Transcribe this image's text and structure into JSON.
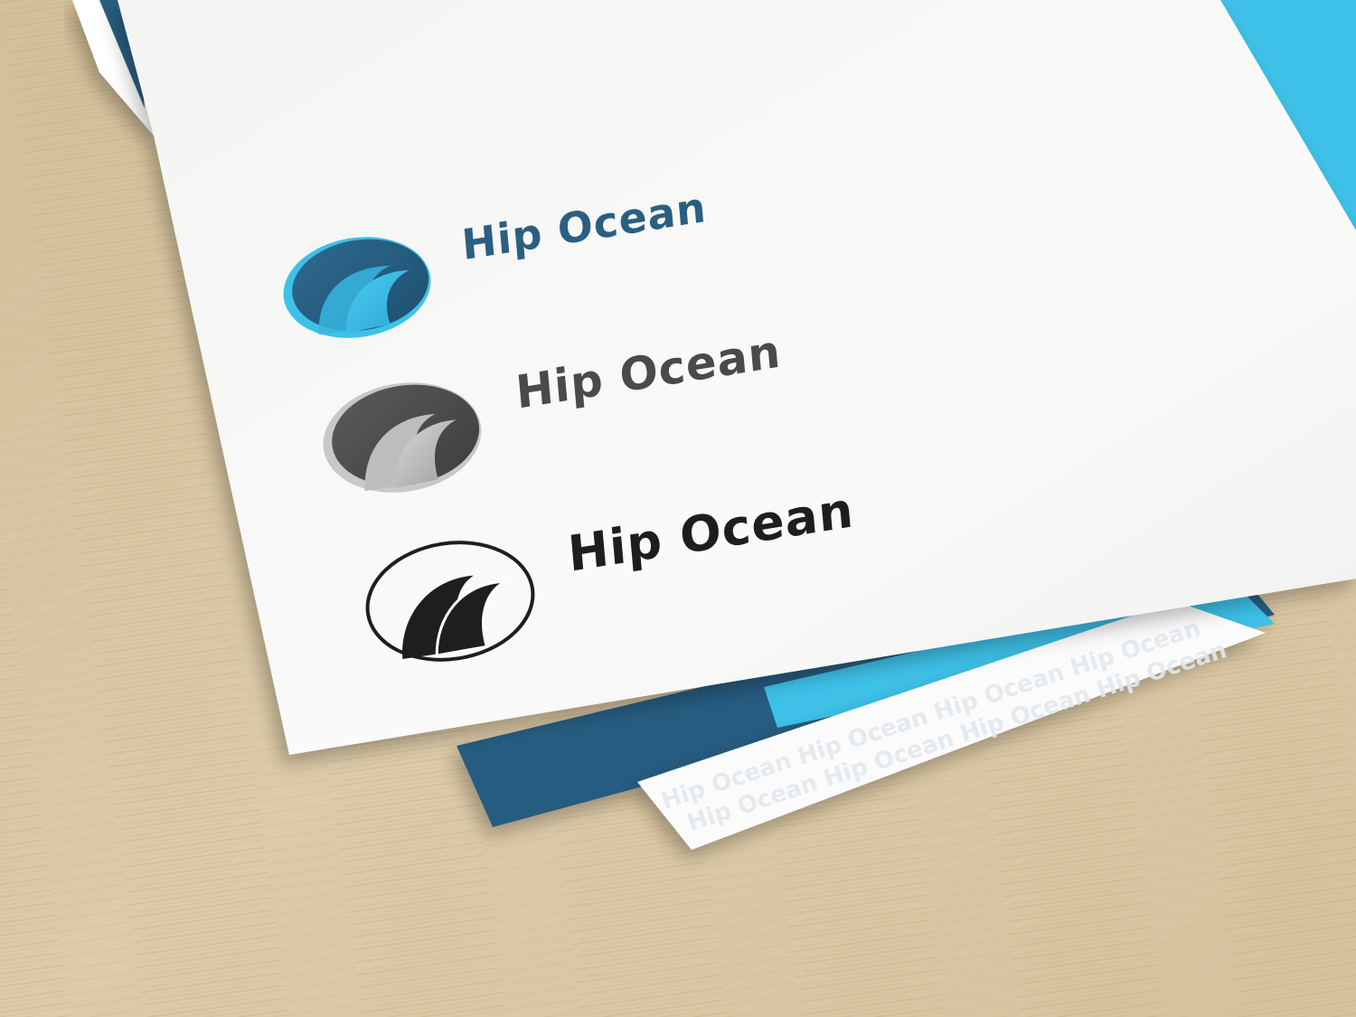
{
  "brand": {
    "name": "Hip Ocean",
    "variants": [
      {
        "label": "Hip Ocean",
        "style": "color"
      },
      {
        "label": "Hip Ocean",
        "style": "grayscale"
      },
      {
        "label": "Hip Ocean",
        "style": "outline"
      }
    ],
    "pattern_text": "Hip Ocean Hip Ocean Hip Ocean Hip Ocean"
  },
  "icons": {
    "logo_mark": "wave-circle-icon"
  },
  "colors": {
    "navy": "#2a5f82",
    "deep_blue": "#245a7e",
    "cyan": "#3ec1e8",
    "light_cyan": "#5fd0f2",
    "gray_dark": "#4a4a4a",
    "gray_light": "#bdbdbd",
    "ink": "#1e1e1e",
    "paper": "#f7f7f5",
    "wood": "#d9c6a3"
  }
}
